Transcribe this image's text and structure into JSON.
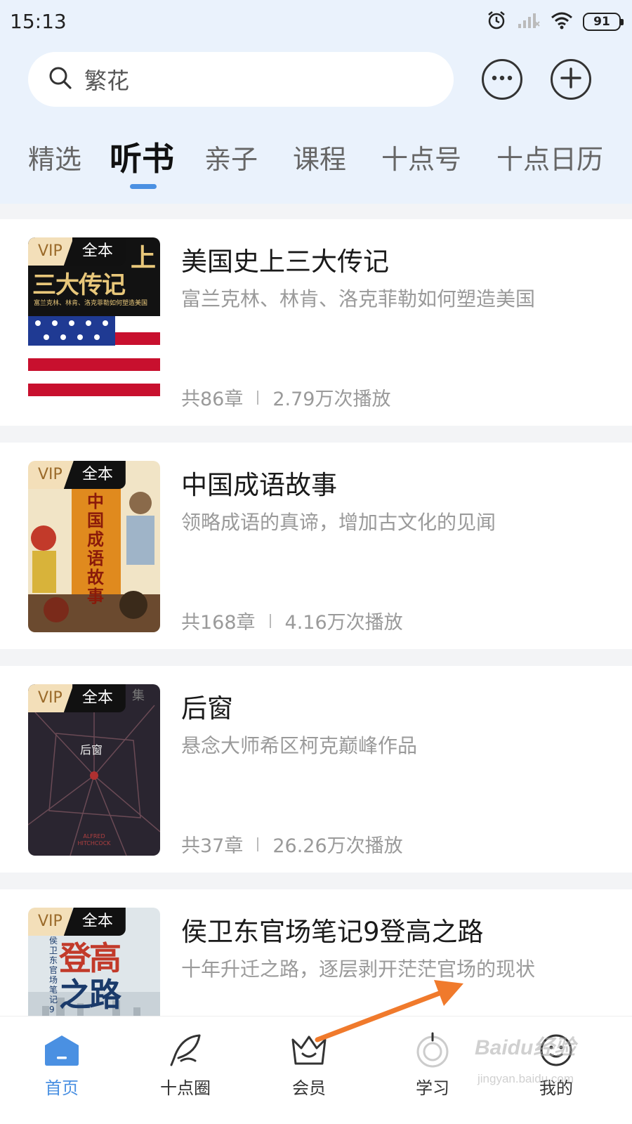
{
  "status_bar": {
    "time": "15:13",
    "battery": "91"
  },
  "search": {
    "value": "繁花"
  },
  "tabs": [
    {
      "label": "精选",
      "active": false
    },
    {
      "label": "听书",
      "active": true
    },
    {
      "label": "亲子",
      "active": false
    },
    {
      "label": "课程",
      "active": false
    },
    {
      "label": "十点号",
      "active": false
    },
    {
      "label": "十点日历",
      "active": false
    }
  ],
  "books": [
    {
      "badge_vip": "VIP",
      "badge_full": "全本",
      "title": "美国史上三大传记",
      "subtitle": "富兰克林、林肯、洛克菲勒如何塑造美国",
      "chapters": "共86章",
      "plays": "2.79万次播放",
      "cover_text": "三大传记",
      "cover_top": "上",
      "cover_caption": "富兰克林、林肯、洛克菲勒如何塑造美国"
    },
    {
      "badge_vip": "VIP",
      "badge_full": "全本",
      "title": "中国成语故事",
      "subtitle": "领略成语的真谛，增加古文化的见闻",
      "chapters": "共168章",
      "plays": "4.16万次播放",
      "cover_text": "中国成语故事"
    },
    {
      "badge_vip": "VIP",
      "badge_full": "全本",
      "title": "后窗",
      "subtitle": "悬念大师希区柯克巅峰作品",
      "chapters": "共37章",
      "plays": "26.26万次播放",
      "cover_text": "后窗",
      "cover_corner": "集",
      "cover_author": "ALFRED HITCHCOCK"
    },
    {
      "badge_vip": "VIP",
      "badge_full": "全本",
      "title": "侯卫东官场笔记9登高之路",
      "subtitle": "十年升迁之路，逐层剥开茫茫官场的现状",
      "cover_text_1": "登高",
      "cover_text_2": "之路",
      "cover_side": "侯卫东官场笔记9"
    }
  ],
  "bottom_nav": [
    {
      "label": "首页",
      "icon": "home-icon",
      "active": true
    },
    {
      "label": "十点圈",
      "icon": "feather-icon",
      "active": false
    },
    {
      "label": "会员",
      "icon": "crown-icon",
      "active": false
    },
    {
      "label": "学习",
      "icon": "learn-icon",
      "active": false
    },
    {
      "label": "我的",
      "icon": "profile-icon",
      "active": false
    }
  ],
  "watermark": {
    "text": "Baidu经验",
    "sub": "jingyan.baidu.com"
  },
  "colors": {
    "accent": "#4a90e2",
    "annotation": "#f07a2c",
    "vip_bg": "#f3dfb9"
  }
}
